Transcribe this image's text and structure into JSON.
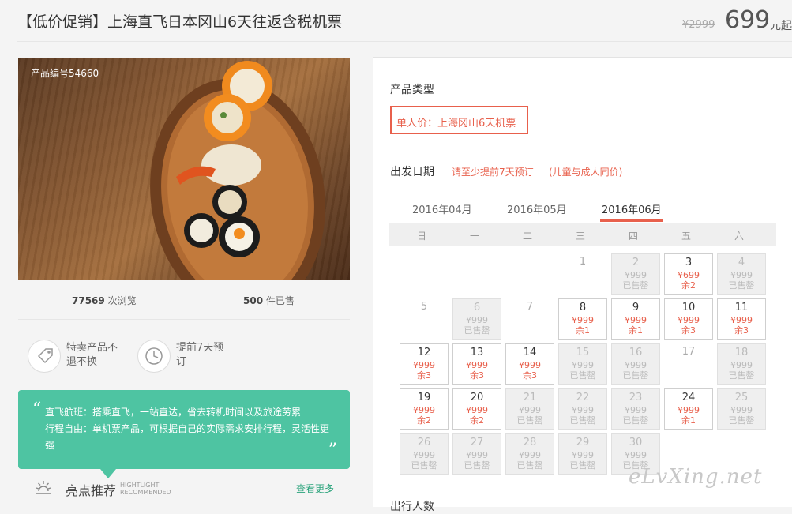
{
  "header": {
    "title": "【低价促销】上海直飞日本冈山6天往返含税机票",
    "old_price": "¥2999",
    "price": "699",
    "price_suffix": "元起"
  },
  "photo": {
    "label": "产品编号54660"
  },
  "stats": {
    "views_num": "77569",
    "views_label": "次浏览",
    "sold_num": "500",
    "sold_label": "件已售"
  },
  "features": [
    {
      "icon": "tag-icon",
      "text": "特卖产品不退不换"
    },
    {
      "icon": "clock-icon",
      "text": "提前7天预订"
    }
  ],
  "bubble": {
    "line1": "直飞航班：搭乘直飞，一站直达，省去转机时间以及旅途劳累",
    "line2": "行程自由：单机票产品，可根据自己的实际需求安排行程，灵活性更强"
  },
  "highlight": {
    "title": "亮点推荐",
    "sub1": "HIGHTLIGHT",
    "sub2": "RECOMMENDED",
    "more": "查看更多"
  },
  "panel": {
    "product_type_title": "产品类型",
    "product_type_option": "单人价：上海冈山6天机票",
    "date_title": "出发日期",
    "date_note1": "请至少提前7天预订",
    "date_note2": "(儿童与成人同价)",
    "months": [
      "2016年04月",
      "2016年05月",
      "2016年06月"
    ],
    "active_month": "2016年06月",
    "weekdays": [
      "日",
      "一",
      "二",
      "三",
      "四",
      "五",
      "六"
    ],
    "next_section": "出行人数"
  },
  "calendar": [
    {
      "day": "1",
      "status": "plain"
    },
    {
      "day": "2",
      "status": "sold",
      "price": "¥999",
      "info": "已售罄"
    },
    {
      "day": "3",
      "status": "avail",
      "price": "¥699",
      "info": "余2"
    },
    {
      "day": "4",
      "status": "sold",
      "price": "¥999",
      "info": "已售罄"
    },
    {
      "day": "5",
      "status": "plain"
    },
    {
      "day": "6",
      "status": "sold",
      "price": "¥999",
      "info": "已售罄"
    },
    {
      "day": "7",
      "status": "plain"
    },
    {
      "day": "8",
      "status": "avail",
      "price": "¥999",
      "info": "余1"
    },
    {
      "day": "9",
      "status": "avail",
      "price": "¥999",
      "info": "余1"
    },
    {
      "day": "10",
      "status": "avail",
      "price": "¥999",
      "info": "余3"
    },
    {
      "day": "11",
      "status": "avail",
      "price": "¥999",
      "info": "余3"
    },
    {
      "day": "12",
      "status": "avail",
      "price": "¥999",
      "info": "余3"
    },
    {
      "day": "13",
      "status": "avail",
      "price": "¥999",
      "info": "余3"
    },
    {
      "day": "14",
      "status": "avail",
      "price": "¥999",
      "info": "余3"
    },
    {
      "day": "15",
      "status": "sold",
      "price": "¥999",
      "info": "已售罄"
    },
    {
      "day": "16",
      "status": "sold",
      "price": "¥999",
      "info": "已售罄"
    },
    {
      "day": "17",
      "status": "plain"
    },
    {
      "day": "18",
      "status": "sold",
      "price": "¥999",
      "info": "已售罄"
    },
    {
      "day": "19",
      "status": "avail",
      "price": "¥999",
      "info": "余2"
    },
    {
      "day": "20",
      "status": "avail",
      "price": "¥999",
      "info": "余2"
    },
    {
      "day": "21",
      "status": "sold",
      "price": "¥999",
      "info": "已售罄"
    },
    {
      "day": "22",
      "status": "sold",
      "price": "¥999",
      "info": "已售罄"
    },
    {
      "day": "23",
      "status": "sold",
      "price": "¥999",
      "info": "已售罄"
    },
    {
      "day": "24",
      "status": "avail",
      "price": "¥999",
      "info": "余1"
    },
    {
      "day": "25",
      "status": "sold",
      "price": "¥999",
      "info": "已售罄"
    },
    {
      "day": "26",
      "status": "sold",
      "price": "¥999",
      "info": "已售罄"
    },
    {
      "day": "27",
      "status": "sold",
      "price": "¥999",
      "info": "已售罄"
    },
    {
      "day": "28",
      "status": "sold",
      "price": "¥999",
      "info": "已售罄"
    },
    {
      "day": "29",
      "status": "sold",
      "price": "¥999",
      "info": "已售罄"
    },
    {
      "day": "30",
      "status": "sold",
      "price": "¥999",
      "info": "已售罄"
    }
  ],
  "watermark": "eLvXing.net",
  "colors": {
    "accent": "#e8604c",
    "green": "#4ec4a2"
  }
}
